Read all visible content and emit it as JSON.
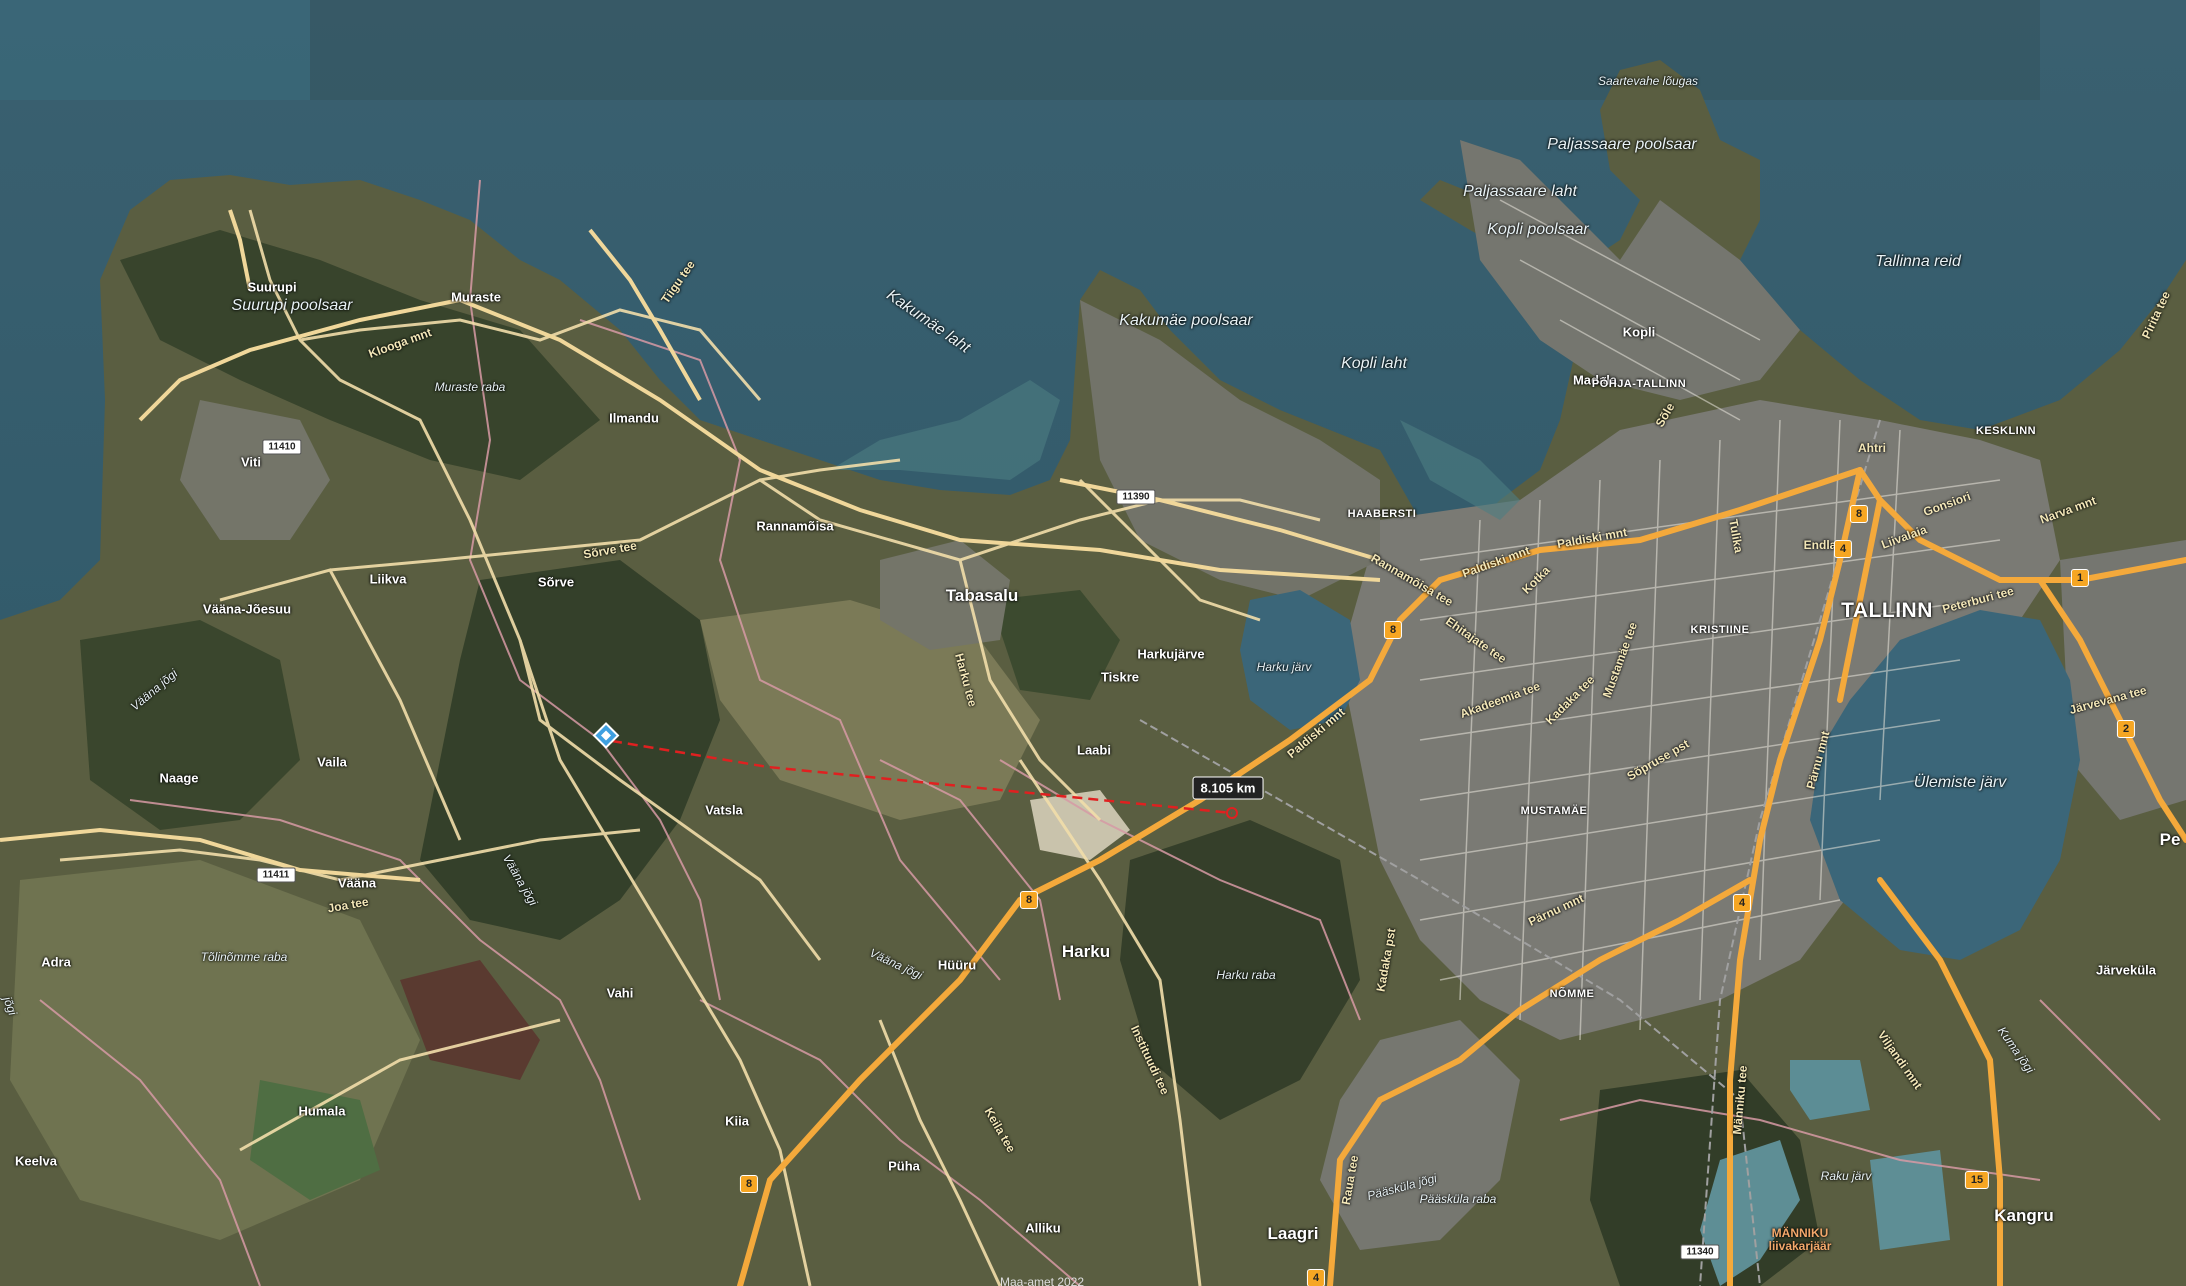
{
  "map": {
    "measurement": {
      "distance_label": "8.105 km"
    },
    "attribution": "Maa-amet 2022",
    "places": [
      {
        "id": "suurupi",
        "text": "Suurupi"
      },
      {
        "id": "muraste",
        "text": "Muraste"
      },
      {
        "id": "ilmandu",
        "text": "Ilmandu"
      },
      {
        "id": "viti",
        "text": "Viti"
      },
      {
        "id": "rannamoisa",
        "text": "Rannamõisa"
      },
      {
        "id": "liikva",
        "text": "Liikva"
      },
      {
        "id": "sorve",
        "text": "Sõrve"
      },
      {
        "id": "vaana-joesuu",
        "text": "Vääna-Jõesuu"
      },
      {
        "id": "tabasalu",
        "text": "Tabasalu"
      },
      {
        "id": "tiskre",
        "text": "Tiskre"
      },
      {
        "id": "harkujarve",
        "text": "Harkujärve"
      },
      {
        "id": "laabi",
        "text": "Laabi"
      },
      {
        "id": "naage",
        "text": "Naage"
      },
      {
        "id": "vaila",
        "text": "Vaila"
      },
      {
        "id": "vatsla",
        "text": "Vatsla"
      },
      {
        "id": "vaana",
        "text": "Vääna"
      },
      {
        "id": "adra",
        "text": "Adra"
      },
      {
        "id": "vahi",
        "text": "Vahi"
      },
      {
        "id": "huuru",
        "text": "Hüüru"
      },
      {
        "id": "harku",
        "text": "Harku"
      },
      {
        "id": "humala",
        "text": "Humala"
      },
      {
        "id": "keelva",
        "text": "Keelva"
      },
      {
        "id": "kiia",
        "text": "Kiia"
      },
      {
        "id": "puha",
        "text": "Püha"
      },
      {
        "id": "alliku",
        "text": "Alliku"
      },
      {
        "id": "laagri",
        "text": "Laagri"
      },
      {
        "id": "kangru",
        "text": "Kangru"
      },
      {
        "id": "jarvekula",
        "text": "Järveküla"
      },
      {
        "id": "kopli",
        "text": "Kopli"
      },
      {
        "id": "madala",
        "text": "Madala"
      },
      {
        "id": "pe",
        "text": "Pe"
      }
    ],
    "city": {
      "text": "TALLINN"
    },
    "districts": [
      {
        "id": "pohja-tallinn",
        "text": "PÕHJA-TALLINN"
      },
      {
        "id": "kesklinn",
        "text": "KESKLINN"
      },
      {
        "id": "haabersti",
        "text": "HAABERSTI"
      },
      {
        "id": "kristiine",
        "text": "KRISTIINE"
      },
      {
        "id": "mustamae",
        "text": "MUSTAMÄE"
      },
      {
        "id": "nomme",
        "text": "NÕMME"
      }
    ],
    "water_features": [
      {
        "id": "kakumae-laht",
        "text": "Kakumäe laht"
      },
      {
        "id": "kopli-laht",
        "text": "Kopli laht"
      },
      {
        "id": "paljassaare-laht",
        "text": "Paljassaare laht"
      },
      {
        "id": "tallinna-reid",
        "text": "Tallinna reid"
      },
      {
        "id": "ulemiste-jarv",
        "text": "Ülemiste järv"
      },
      {
        "id": "harku-jarv",
        "text": "Harku järv"
      },
      {
        "id": "raku-jarv",
        "text": "Raku järv"
      }
    ],
    "natural_features": [
      {
        "id": "suurupi-poolsaar",
        "text": "Suurupi poolsaar"
      },
      {
        "id": "kakumae-poolsaar",
        "text": "Kakumäe poolsaar"
      },
      {
        "id": "kopli-poolsaar",
        "text": "Kopli poolsaar"
      },
      {
        "id": "paljassaare-poolsaar",
        "text": "Paljassaare poolsaar"
      },
      {
        "id": "saartevahe-lougas",
        "text": "Saartevahe lõugas"
      },
      {
        "id": "muraste-raba",
        "text": "Muraste raba"
      },
      {
        "id": "tolinomme-raba",
        "text": "Tõlinõmme raba"
      },
      {
        "id": "harku-raba",
        "text": "Harku raba"
      },
      {
        "id": "paaskula-raba",
        "text": "Pääsküla raba"
      },
      {
        "id": "vaana-jogi-1",
        "text": "Vääna jõgi"
      },
      {
        "id": "vaana-jogi-2",
        "text": "Vääna jõgi"
      },
      {
        "id": "vaana-jogi-3",
        "text": "Vääna jõgi"
      },
      {
        "id": "kuma-jogi",
        "text": "Kuma jõgi"
      },
      {
        "id": "paaskula-jogi",
        "text": "Pääsküla jõgi"
      },
      {
        "id": "jogi-left",
        "text": "jõgi"
      },
      {
        "id": "manniku",
        "text": "MÄNNIKU\nliivakarjäär"
      }
    ],
    "roads": [
      {
        "id": "klooga-mnt",
        "text": "Klooga mnt"
      },
      {
        "id": "tiigu-tee",
        "text": "Tiigu tee"
      },
      {
        "id": "sorve-tee",
        "text": "Sõrve tee"
      },
      {
        "id": "joa-tee",
        "text": "Joa tee"
      },
      {
        "id": "harkutee",
        "text": "Harku tee"
      },
      {
        "id": "paldiski-mnt-1",
        "text": "Paldiski mnt"
      },
      {
        "id": "paldiski-mnt-2",
        "text": "Paldiski mnt"
      },
      {
        "id": "paldiski-mnt-3",
        "text": "Paldiski mnt"
      },
      {
        "id": "rannamoisa-tee",
        "text": "Rannamõisa tee"
      },
      {
        "id": "ehitajate-tee",
        "text": "Ehitajate tee"
      },
      {
        "id": "akadeemia-tee",
        "text": "Akadeemia tee"
      },
      {
        "id": "kadaka-tee",
        "text": "Kadaka tee"
      },
      {
        "id": "mustamae-tee",
        "text": "Mustamäe tee"
      },
      {
        "id": "soprusepst",
        "text": "Sõpruse pst"
      },
      {
        "id": "parnu-mnt-1",
        "text": "Pärnu mnt"
      },
      {
        "id": "parnu-mnt-2",
        "text": "Pärnu mnt"
      },
      {
        "id": "kotka",
        "text": "Kotka"
      },
      {
        "id": "kadaka-pst",
        "text": "Kadaka pst"
      },
      {
        "id": "tulika",
        "text": "Tulika"
      },
      {
        "id": "sore",
        "text": "Sõle"
      },
      {
        "id": "endla",
        "text": "Endla"
      },
      {
        "id": "ahtri",
        "text": "Ahtri"
      },
      {
        "id": "gonsiori",
        "text": "Gonsiori"
      },
      {
        "id": "liivalaia",
        "text": "Liivalaia"
      },
      {
        "id": "narva-mnt",
        "text": "Narva mnt"
      },
      {
        "id": "peterburi-tee",
        "text": "Peterburi tee"
      },
      {
        "id": "jarvevana-tee",
        "text": "Järvevana tee"
      },
      {
        "id": "pirita-tee",
        "text": "Pirita tee"
      },
      {
        "id": "viljandi-mnt",
        "text": "Viljandi mnt"
      },
      {
        "id": "manniku-tee",
        "text": "Männiku tee"
      },
      {
        "id": "instituudi-tee",
        "text": "Instituudi tee"
      },
      {
        "id": "keila-tee",
        "text": "Keila tee"
      },
      {
        "id": "rauda-tee",
        "text": "Raua tee"
      }
    ],
    "shields": [
      {
        "id": "s11410",
        "text": "11410",
        "kind": "white"
      },
      {
        "id": "s11390",
        "text": "11390",
        "kind": "white"
      },
      {
        "id": "s11411",
        "text": "11411",
        "kind": "white"
      },
      {
        "id": "s11340",
        "text": "11340",
        "kind": "white"
      },
      {
        "id": "s8a",
        "text": "8",
        "kind": "orange"
      },
      {
        "id": "s8b",
        "text": "8",
        "kind": "orange"
      },
      {
        "id": "s8c",
        "text": "8",
        "kind": "orange"
      },
      {
        "id": "s8d",
        "text": "8",
        "kind": "orange"
      },
      {
        "id": "s4a",
        "text": "4",
        "kind": "orange"
      },
      {
        "id": "s4b",
        "text": "4",
        "kind": "orange"
      },
      {
        "id": "s4c",
        "text": "4",
        "kind": "orange"
      },
      {
        "id": "s1",
        "text": "1",
        "kind": "orange"
      },
      {
        "id": "s2",
        "text": "2",
        "kind": "orange"
      },
      {
        "id": "s15",
        "text": "15",
        "kind": "orange"
      }
    ],
    "colors": {
      "sea": "#2e5563",
      "shallow": "#5a8a8a",
      "land": "#5b5f42",
      "forest": "#33402a",
      "urban": "#7d7d78",
      "major_road": "#f4a93b",
      "minor_road": "#f2deaa",
      "admin_boundary": "#d79aa5",
      "measure_line": "#e02020"
    }
  }
}
